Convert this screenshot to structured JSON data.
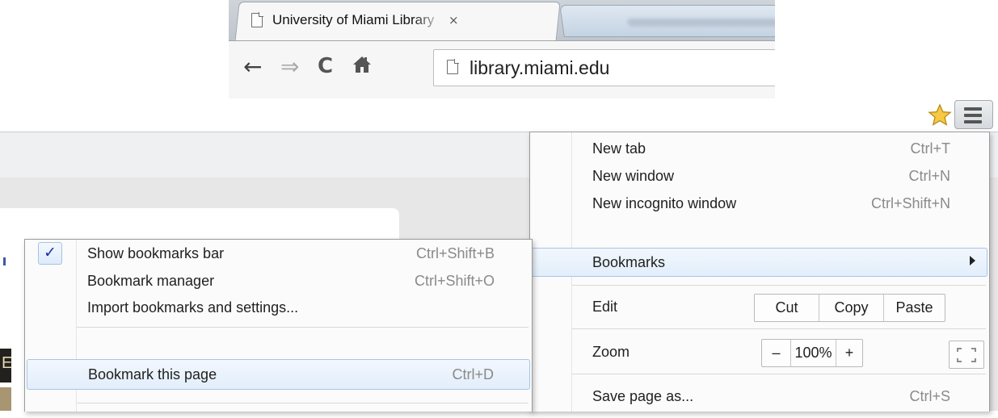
{
  "tab": {
    "title": "University of Miami Library",
    "close_glyph": "×"
  },
  "toolbar": {
    "back_glyph": "←",
    "forward_glyph": "⇒",
    "reload_glyph": "C",
    "url": "library.miami.edu"
  },
  "main_menu": {
    "items": [
      {
        "label": "New tab",
        "shortcut": "Ctrl+T"
      },
      {
        "label": "New window",
        "shortcut": "Ctrl+N"
      },
      {
        "label": "New incognito window",
        "shortcut": "Ctrl+Shift+N"
      },
      {
        "label": "Bookmarks",
        "shortcut": ""
      },
      {
        "label": "Edit",
        "shortcut": ""
      },
      {
        "label": "Zoom",
        "shortcut": ""
      },
      {
        "label": "Save page as...",
        "shortcut": "Ctrl+S"
      }
    ],
    "edit_buttons": [
      "Cut",
      "Copy",
      "Paste"
    ],
    "zoom": {
      "minus": "–",
      "level": "100%",
      "plus": "+"
    }
  },
  "bookmarks_menu": {
    "items": [
      {
        "label": "Show bookmarks bar",
        "shortcut": "Ctrl+Shift+B",
        "checked": true
      },
      {
        "label": "Bookmark manager",
        "shortcut": "Ctrl+Shift+O"
      },
      {
        "label": "Import bookmarks and settings...",
        "shortcut": ""
      },
      {
        "label": "Bookmark this page",
        "shortcut": "Ctrl+D"
      }
    ],
    "check_glyph": "✓"
  },
  "icons": {
    "star": "bookmark-star-icon",
    "menu": "hamburger-menu-icon",
    "home": "home-icon",
    "page": "page-icon"
  },
  "colors": {
    "highlight_border": "#a9c3e6",
    "star_fill": "#f7c843",
    "check": "#1a2fa8"
  }
}
